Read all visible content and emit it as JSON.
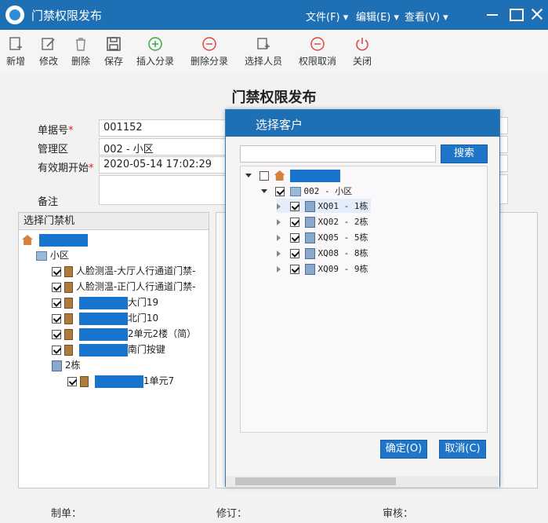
{
  "window": {
    "title": "门禁权限发布",
    "menus": [
      "文件(F)",
      "编辑(E)",
      "查看(V)"
    ]
  },
  "toolbar": {
    "new": "新增",
    "edit": "修改",
    "delete": "删除",
    "save": "保存",
    "insert_entry": "插入分录",
    "delete_entry": "删除分录",
    "select_person": "选择人员",
    "revoke": "权限取消",
    "close": "关闭"
  },
  "form": {
    "title": "门禁权限发布",
    "doc_no_label": "单据号",
    "doc_no": "001152",
    "area_label": "管理区",
    "area": "002 - 小区",
    "valid_from_label": "有效期开始",
    "valid_from": "2020-05-14 17:02:29",
    "remark_label": "备注"
  },
  "left_panel": {
    "title": "选择门禁机",
    "community": "小区",
    "devices": [
      "人脸测温-大厅人行通道门禁-",
      "人脸测温-正门人行通道门禁-",
      "大门19",
      "北门10",
      "2单元2楼（简）",
      "南门按键"
    ],
    "building": "2栋",
    "sub_device": "1单元7"
  },
  "footer": {
    "creator": "制单：",
    "reviser": "修订：",
    "auditor": "审核："
  },
  "dialog": {
    "title": "选择客户",
    "search_button": "搜索",
    "area_node": "002 - 小区",
    "buildings": [
      "XQ01 - 1栋",
      "XQ02 - 2栋",
      "XQ05 - 5栋",
      "XQ08 - 8栋",
      "XQ09 - 9栋"
    ],
    "ok_button": "确定(O)",
    "cancel_button": "取消(C)"
  }
}
